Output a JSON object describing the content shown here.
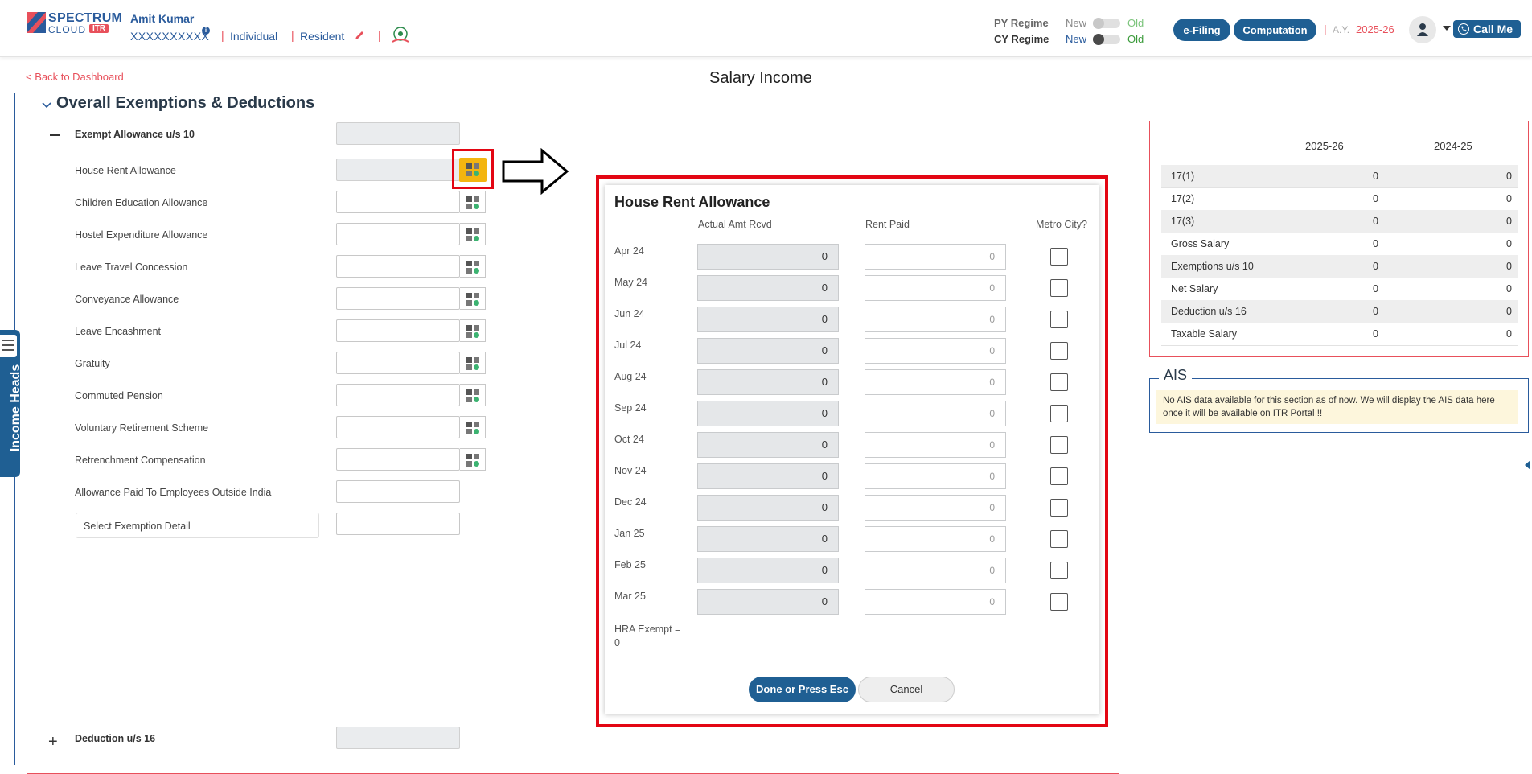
{
  "header": {
    "logo_spectrum": "SPECTRUM",
    "logo_cloud": "CLOUD",
    "logo_itr": "ITR",
    "user_name": "Amit Kumar",
    "user_pan": "XXXXXXXXXX",
    "status": "Individual",
    "residency": "Resident",
    "py_regime": "PY Regime",
    "cy_regime": "CY Regime",
    "new_label": "New",
    "old_label": "Old",
    "efiling_btn": "e-Filing",
    "computation_btn": "Computation",
    "ay_label": "A.Y.",
    "ay_value": "2025-26",
    "call_btn": "Call Me"
  },
  "page": {
    "back_link": "< Back to Dashboard",
    "title": "Salary Income"
  },
  "side_tab": {
    "label": "Income Heads"
  },
  "exemptions": {
    "legend": "Overall Exemptions & Deductions",
    "exempt_allowance": "Exempt Allowance u/s 10",
    "items": [
      "House Rent Allowance",
      "Children Education Allowance",
      "Hostel Expenditure Allowance",
      "Leave Travel Concession",
      "Conveyance Allowance",
      "Leave Encashment",
      "Gratuity",
      "Commuted Pension",
      "Voluntary Retirement Scheme",
      "Retrenchment Compensation",
      "Allowance Paid To Employees Outside India"
    ],
    "select_detail": "Select Exemption Detail",
    "deduction_16": "Deduction u/s 16"
  },
  "modal": {
    "title": "House Rent Allowance",
    "col_actual": "Actual Amt Rcvd",
    "col_rent": "Rent Paid",
    "col_metro": "Metro City?",
    "rows": [
      {
        "month": "Apr 24",
        "actual": "0",
        "rent_placeholder": "0"
      },
      {
        "month": "May 24",
        "actual": "0",
        "rent_placeholder": "0"
      },
      {
        "month": "Jun 24",
        "actual": "0",
        "rent_placeholder": "0"
      },
      {
        "month": "Jul 24",
        "actual": "0",
        "rent_placeholder": "0"
      },
      {
        "month": "Aug 24",
        "actual": "0",
        "rent_placeholder": "0"
      },
      {
        "month": "Sep 24",
        "actual": "0",
        "rent_placeholder": "0"
      },
      {
        "month": "Oct 24",
        "actual": "0",
        "rent_placeholder": "0"
      },
      {
        "month": "Nov 24",
        "actual": "0",
        "rent_placeholder": "0"
      },
      {
        "month": "Dec 24",
        "actual": "0",
        "rent_placeholder": "0"
      },
      {
        "month": "Jan 25",
        "actual": "0",
        "rent_placeholder": "0"
      },
      {
        "month": "Feb 25",
        "actual": "0",
        "rent_placeholder": "0"
      },
      {
        "month": "Mar 25",
        "actual": "0",
        "rent_placeholder": "0"
      }
    ],
    "hra_exempt_label": "HRA Exempt =",
    "hra_exempt_value": "0",
    "done_btn": "Done or Press Esc",
    "cancel_btn": "Cancel"
  },
  "summary": {
    "col_current": "2025-26",
    "col_previous": "2024-25",
    "rows": [
      {
        "label": "17(1)",
        "current": "0",
        "previous": "0"
      },
      {
        "label": "17(2)",
        "current": "0",
        "previous": "0"
      },
      {
        "label": "17(3)",
        "current": "0",
        "previous": "0"
      },
      {
        "label": "Gross Salary",
        "current": "0",
        "previous": "0"
      },
      {
        "label": "Exemptions u/s 10",
        "current": "0",
        "previous": "0"
      },
      {
        "label": "Net Salary",
        "current": "0",
        "previous": "0"
      },
      {
        "label": "Deduction u/s 16",
        "current": "0",
        "previous": "0"
      },
      {
        "label": "Taxable Salary",
        "current": "0",
        "previous": "0"
      }
    ]
  },
  "ais": {
    "legend": "AIS",
    "message": "No AIS data available for this section as of now. We will display the AIS data here once it will be available on ITR Portal !!"
  },
  "colors": {
    "brand_blue": "#1f5f93",
    "accent_red": "#e8505b",
    "highlight_red": "#e30613",
    "calc_yellow": "#f3b510"
  }
}
